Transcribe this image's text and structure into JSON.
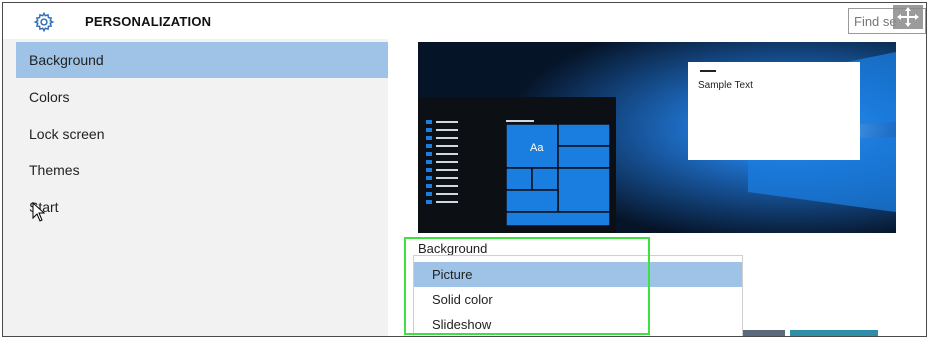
{
  "header": {
    "title": "PERSONALIZATION",
    "gear_icon": "gear-icon",
    "find_placeholder": "Find se",
    "move_icon": "move-icon"
  },
  "sidebar": {
    "items": [
      {
        "label": "Background",
        "active": true
      },
      {
        "label": "Colors",
        "active": false
      },
      {
        "label": "Lock screen",
        "active": false
      },
      {
        "label": "Themes",
        "active": false
      },
      {
        "label": "Start",
        "active": false
      }
    ]
  },
  "preview": {
    "sample_text": "Sample Text",
    "tile_label": "Aa"
  },
  "background_dropdown": {
    "label": "Background",
    "options": [
      "Picture",
      "Solid color",
      "Slideshow"
    ],
    "selected": "Picture"
  },
  "colors": {
    "accent": "#0078d7",
    "selection": "#9ec3e6",
    "highlight_box": "#3ee23e"
  }
}
